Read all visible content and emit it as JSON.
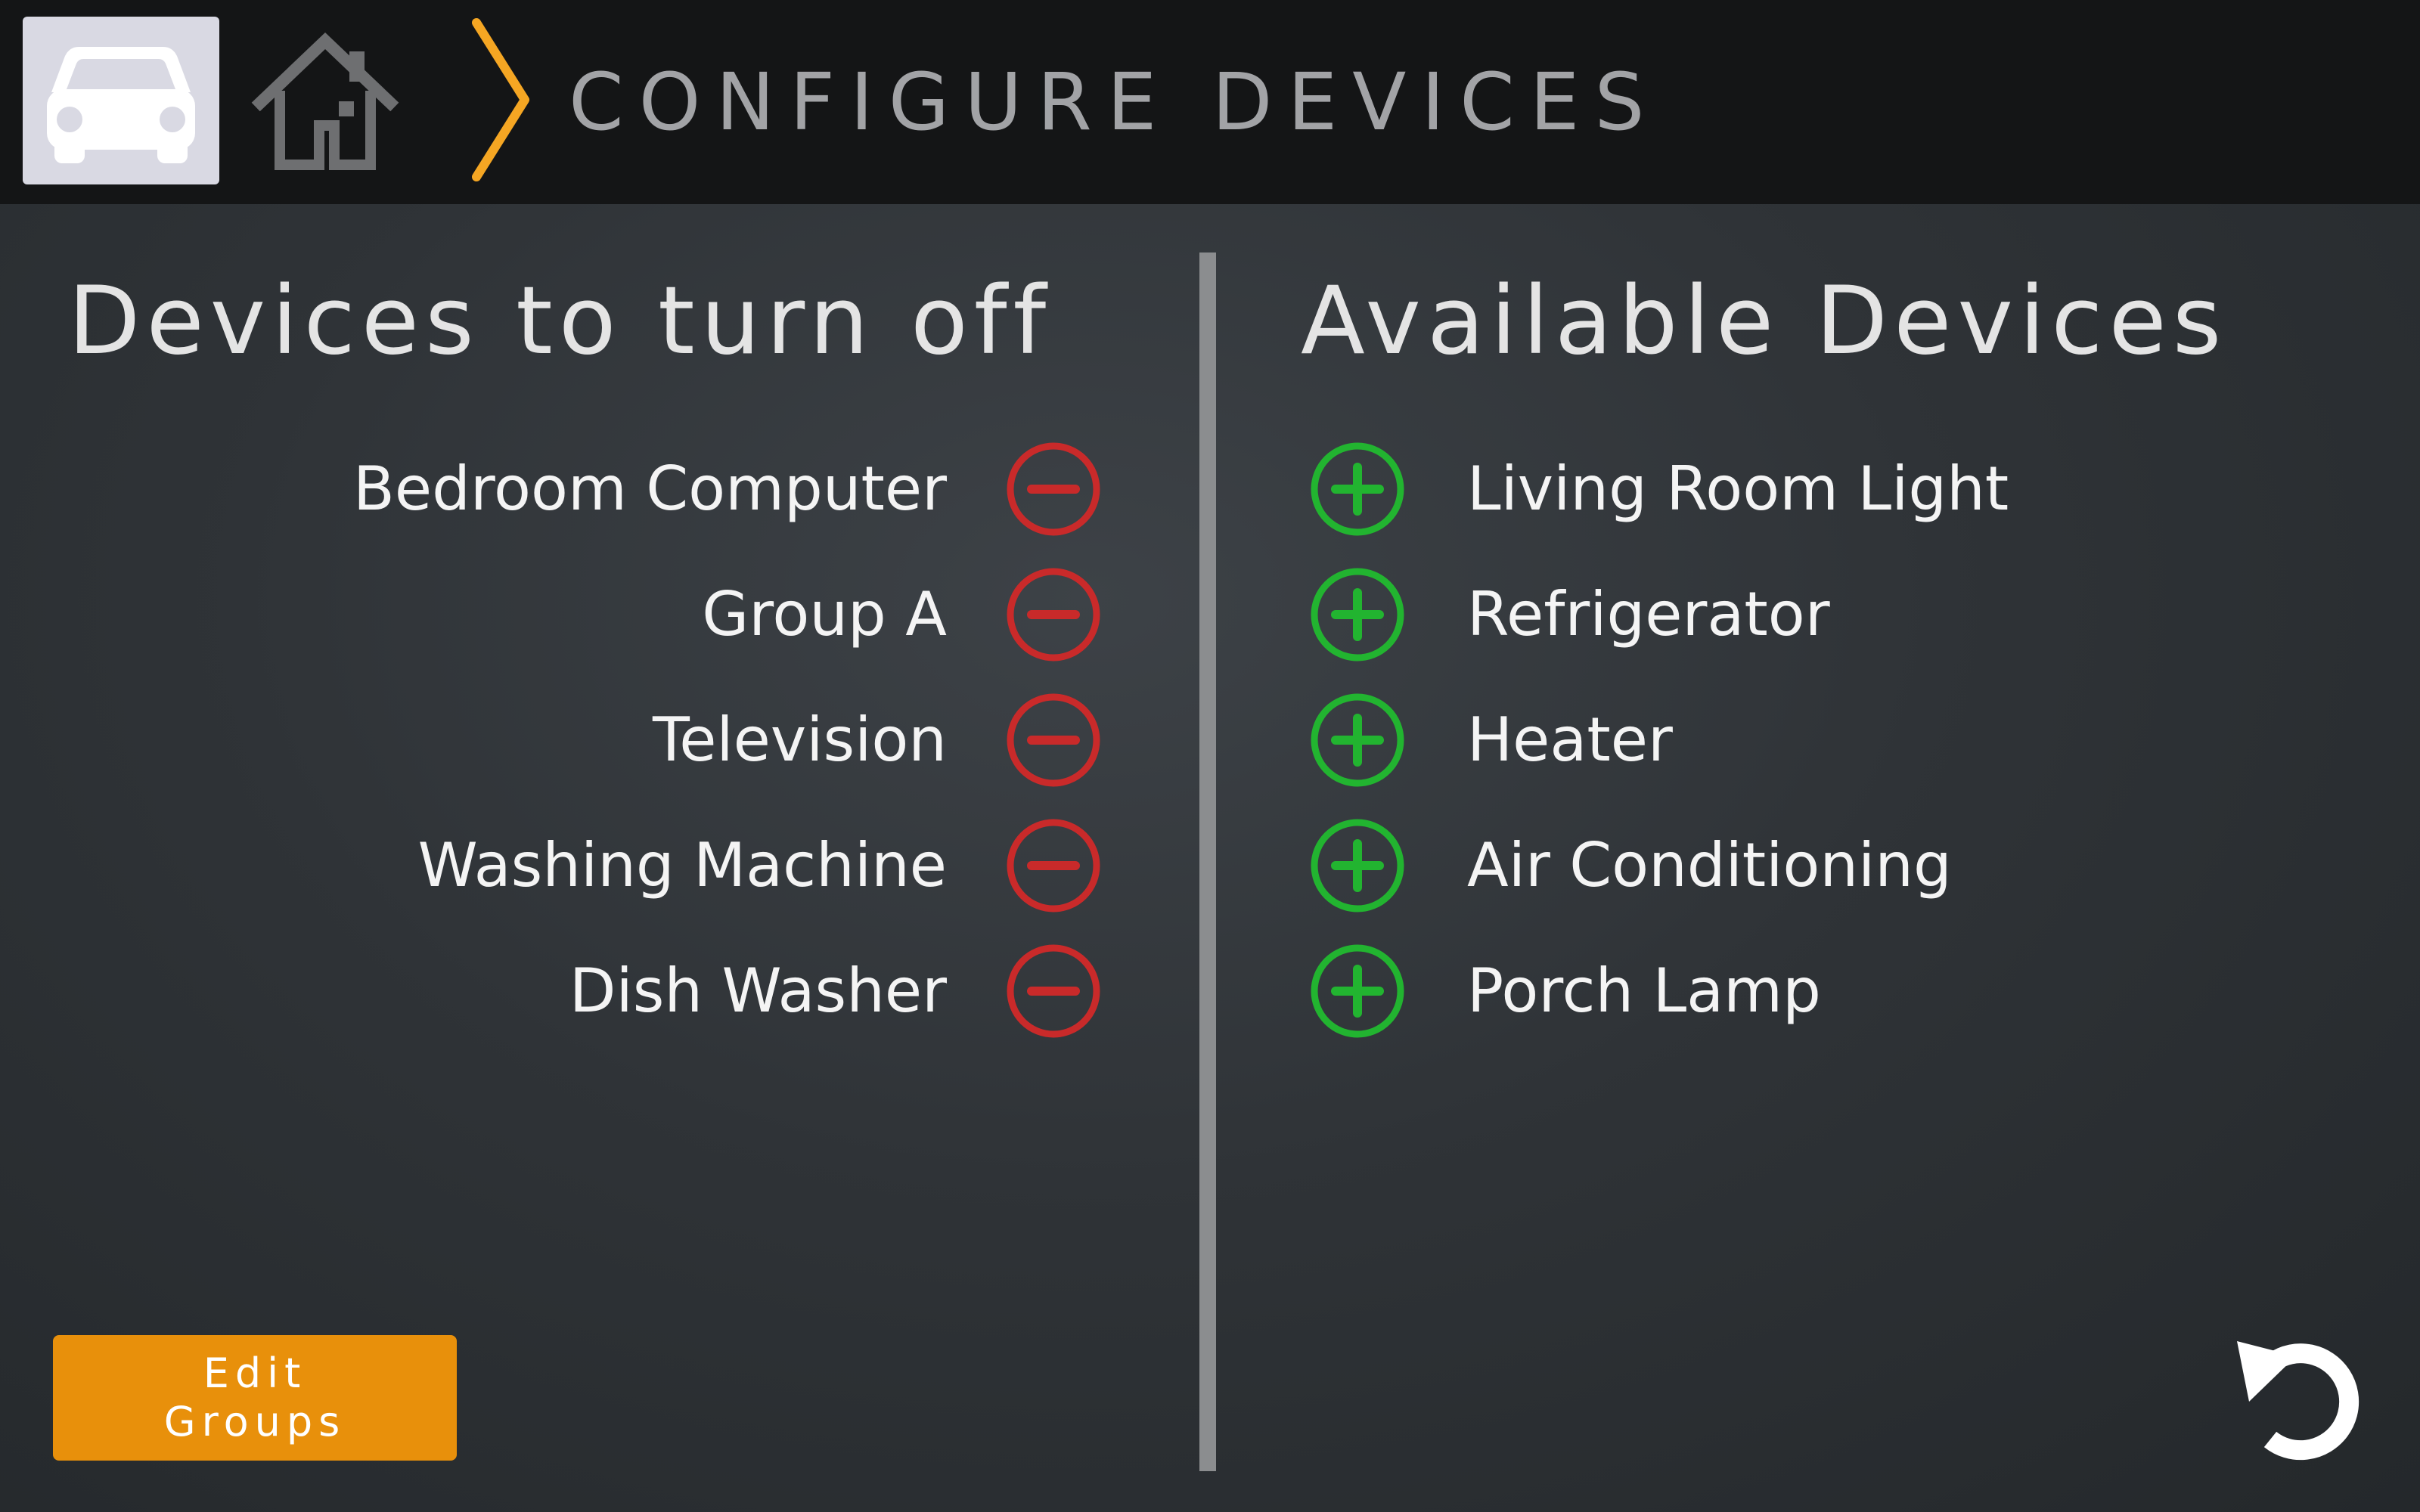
{
  "header": {
    "title": "CONFIGURE DEVICES",
    "car_icon": "car-icon",
    "home_icon": "home-icon",
    "breadcrumb_separator_icon": "chevron-right-icon",
    "accent_color": "#f5a623"
  },
  "left_column": {
    "heading": "Devices to turn off",
    "action_icon": "minus-circle-icon",
    "action_color": "#c92a2a",
    "items": [
      {
        "label": "Bedroom Computer"
      },
      {
        "label": "Group A"
      },
      {
        "label": "Television"
      },
      {
        "label": "Washing Machine"
      },
      {
        "label": "Dish Washer"
      }
    ]
  },
  "right_column": {
    "heading": "Available Devices",
    "action_icon": "plus-circle-icon",
    "action_color": "#22b430",
    "items": [
      {
        "label": "Living Room Light"
      },
      {
        "label": "Refrigerator"
      },
      {
        "label": "Heater"
      },
      {
        "label": "Air Conditioning"
      },
      {
        "label": "Porch Lamp"
      }
    ]
  },
  "footer": {
    "edit_groups_line1": "Edit",
    "edit_groups_line2": "Groups",
    "edit_groups_color": "#e8900b",
    "undo_icon": "undo-icon"
  }
}
